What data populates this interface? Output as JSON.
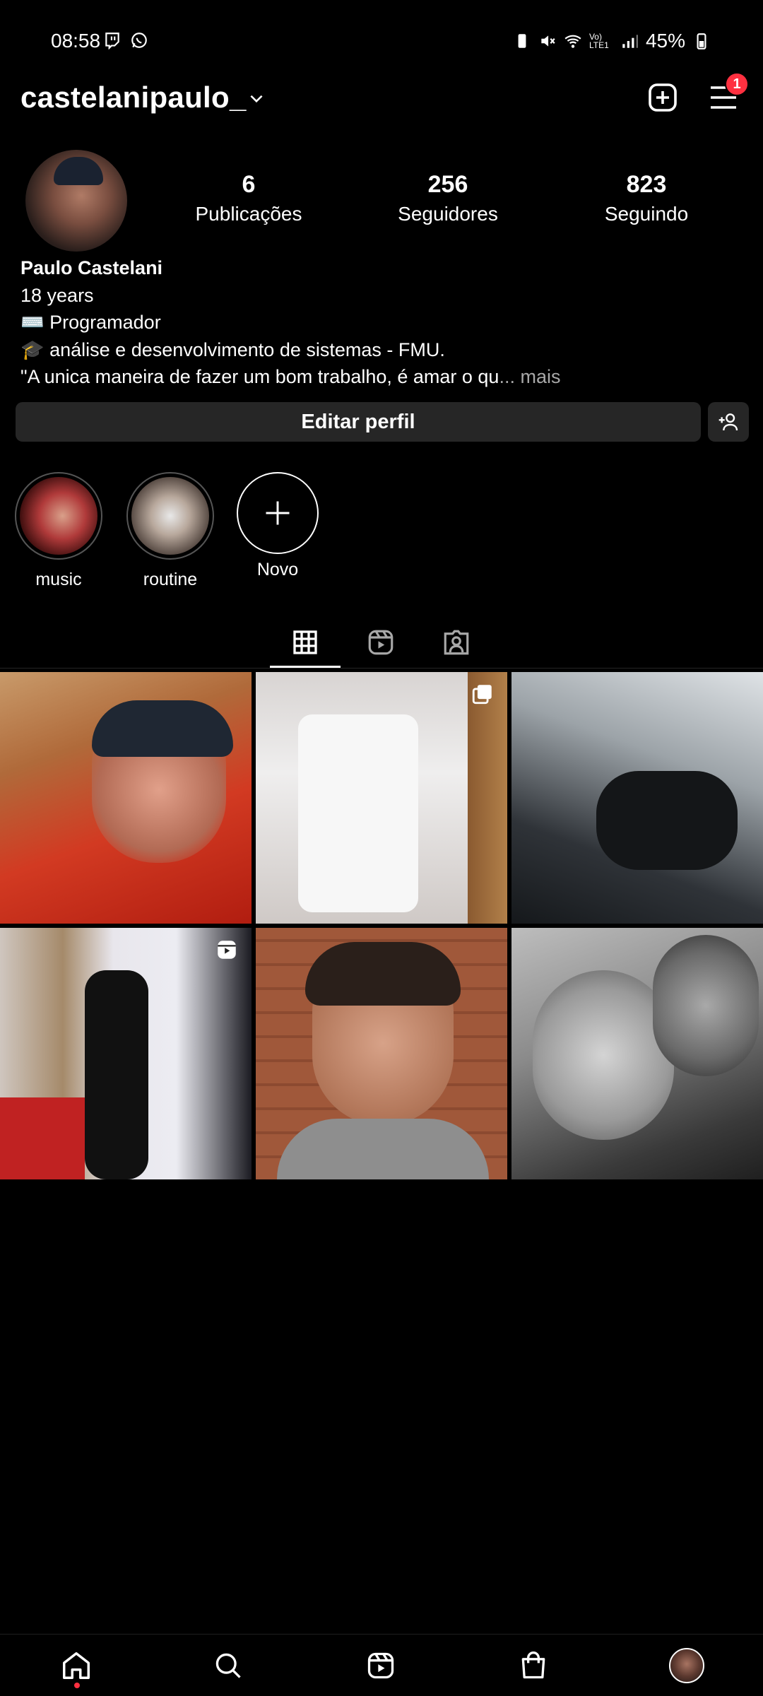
{
  "status_bar": {
    "time": "08:58",
    "battery": "45%",
    "left_icons": [
      "twitch-icon",
      "whatsapp-icon"
    ],
    "right_icons": [
      "battery-saver-icon",
      "mute-icon",
      "wifi-icon",
      "volte-icon",
      "signal-icon",
      "battery-icon"
    ],
    "network_label": "Vo) LTE1"
  },
  "header": {
    "username": "castelanipaulo_",
    "notification_count": "1"
  },
  "profile": {
    "stats": [
      {
        "value": "6",
        "label": "Publicações"
      },
      {
        "value": "256",
        "label": "Seguidores"
      },
      {
        "value": "823",
        "label": "Seguindo"
      }
    ],
    "bio": {
      "name": "Paulo Castelani",
      "line1": "18 years",
      "line2": "⌨️ Programador",
      "line3": "🎓 análise e desenvolvimento de sistemas - FMU.",
      "line4": "\"A unica maneira de fazer um bom trabalho, é amar o qu",
      "ellipsis": "...",
      "more": " mais"
    },
    "edit_button": "Editar perfil"
  },
  "highlights": [
    {
      "label": "music"
    },
    {
      "label": "routine"
    },
    {
      "label": "Novo"
    }
  ],
  "tabs": [
    "posts-grid",
    "reels",
    "tagged"
  ],
  "grid": {
    "cells": [
      {
        "badge": ""
      },
      {
        "badge": "carousel-icon"
      },
      {
        "badge": ""
      },
      {
        "badge": "reels-icon"
      },
      {
        "badge": ""
      },
      {
        "badge": ""
      }
    ]
  },
  "bottom_nav": [
    "home-icon",
    "search-icon",
    "reels-icon",
    "shop-icon",
    "profile-avatar"
  ],
  "colors": {
    "background": "#000000",
    "button": "#262626",
    "badge": "#ff3040",
    "muted_text": "#a8a8a8"
  }
}
